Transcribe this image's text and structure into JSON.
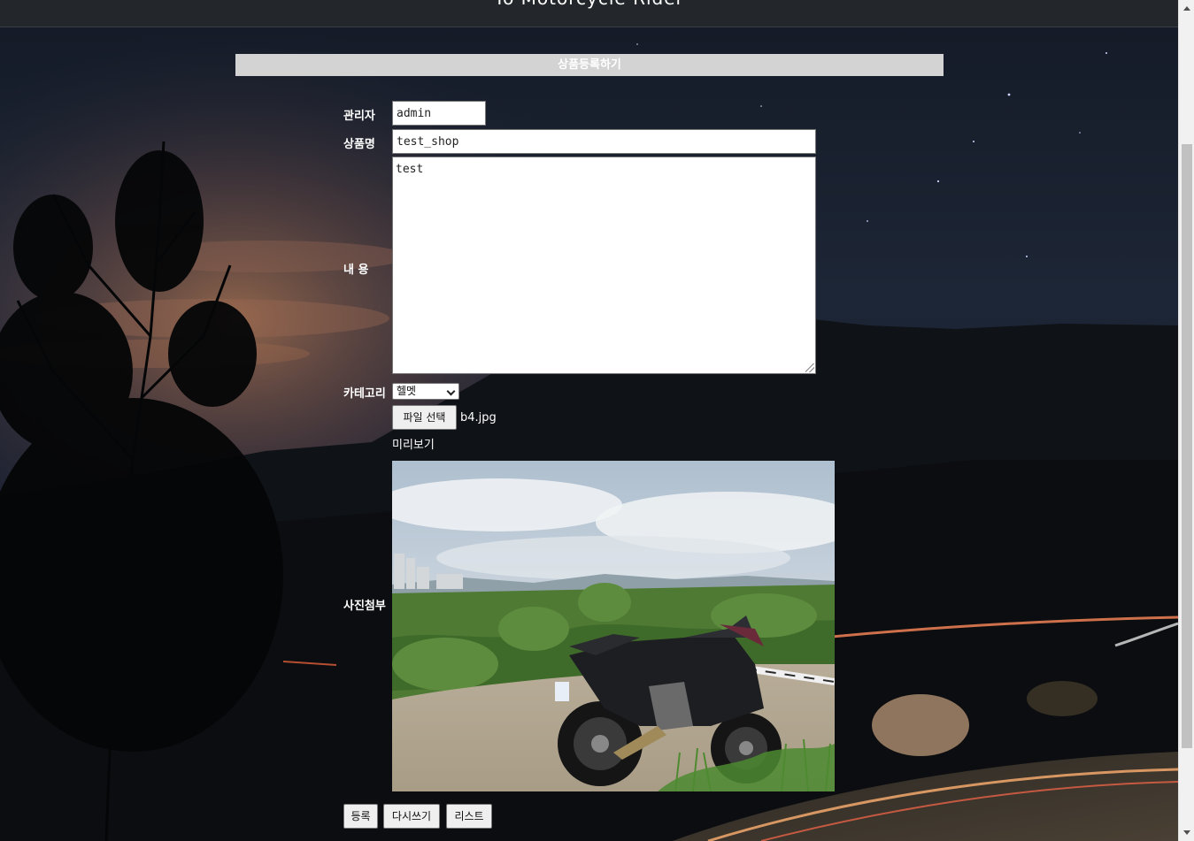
{
  "header": {
    "title": "To Motorcycle Rider"
  },
  "form": {
    "heading": "상품등록하기",
    "admin": {
      "label": "관리자",
      "value": "admin"
    },
    "product_name": {
      "label": "상품명",
      "value": "test_shop"
    },
    "content": {
      "label": "내 용",
      "value": "test"
    },
    "category": {
      "label": "카테고리",
      "selected": "헬멧"
    },
    "attachment": {
      "label": "사진첨부",
      "button_label": "파일 선택",
      "file_name": "b4.jpg",
      "preview_label": "미리보기"
    }
  },
  "buttons": {
    "submit": "등록",
    "rewrite": "다시쓰기",
    "list": "리스트"
  },
  "colors": {
    "header_bg": "#23272b",
    "heading_bar": "#d3d3d3",
    "label_text": "#ffffff"
  }
}
